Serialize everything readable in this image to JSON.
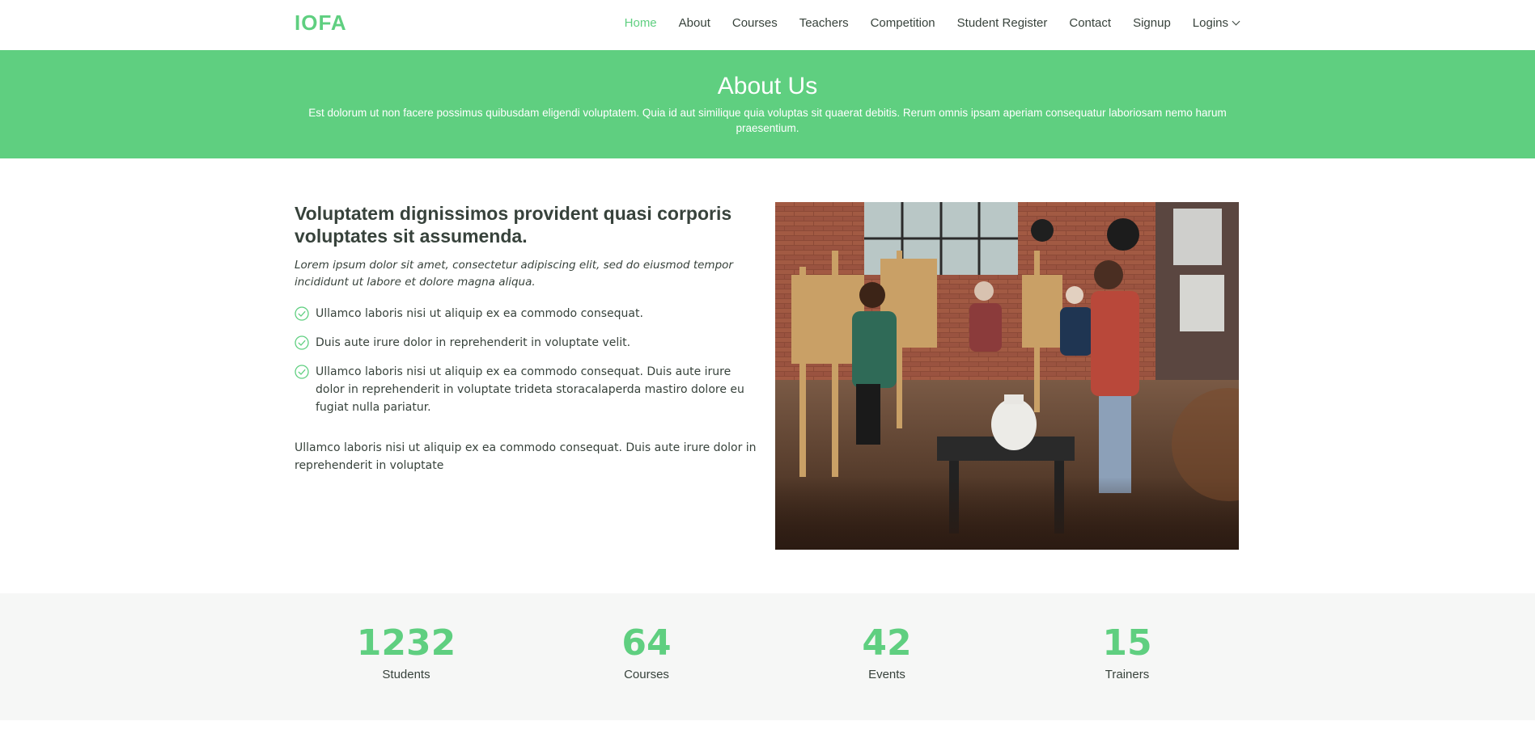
{
  "header": {
    "logo": "IOFA",
    "nav": [
      {
        "label": "Home",
        "active": true
      },
      {
        "label": "About"
      },
      {
        "label": "Courses"
      },
      {
        "label": "Teachers"
      },
      {
        "label": "Competition"
      },
      {
        "label": "Student Register"
      },
      {
        "label": "Contact"
      },
      {
        "label": "Signup"
      },
      {
        "label": "Logins",
        "dropdown": true
      }
    ]
  },
  "banner": {
    "title": "About Us",
    "description": "Est dolorum ut non facere possimus quibusdam eligendi voluptatem. Quia id aut similique quia voluptas sit quaerat debitis. Rerum omnis ipsam aperiam consequatur laboriosam nemo harum praesentium."
  },
  "about": {
    "heading": "Voluptatem dignissimos provident quasi corporis voluptates sit assumenda.",
    "lead": "Lorem ipsum dolor sit amet, consectetur adipiscing elit, sed do eiusmod tempor incididunt ut labore et dolore magna aliqua.",
    "checks": [
      "Ullamco laboris nisi ut aliquip ex ea commodo consequat.",
      "Duis aute irure dolor in reprehenderit in voluptate velit.",
      "Ullamco laboris nisi ut aliquip ex ea commodo consequat. Duis aute irure dolor in reprehenderit in voluptate trideta storacalaperda mastiro dolore eu fugiat nulla pariatur."
    ],
    "paragraph": "Ullamco laboris nisi ut aliquip ex ea commodo consequat. Duis aute irure dolor in reprehenderit in voluptate"
  },
  "counts": [
    {
      "number": "1232",
      "label": "Students"
    },
    {
      "number": "64",
      "label": "Courses"
    },
    {
      "number": "42",
      "label": "Events"
    },
    {
      "number": "15",
      "label": "Trainers"
    }
  ],
  "colors": {
    "accent": "#5fcf80",
    "text": "#37423b",
    "counts_bg": "#f6f7f6"
  },
  "icons": {
    "check": "check-circle-icon",
    "dropdown": "chevron-down-icon"
  }
}
